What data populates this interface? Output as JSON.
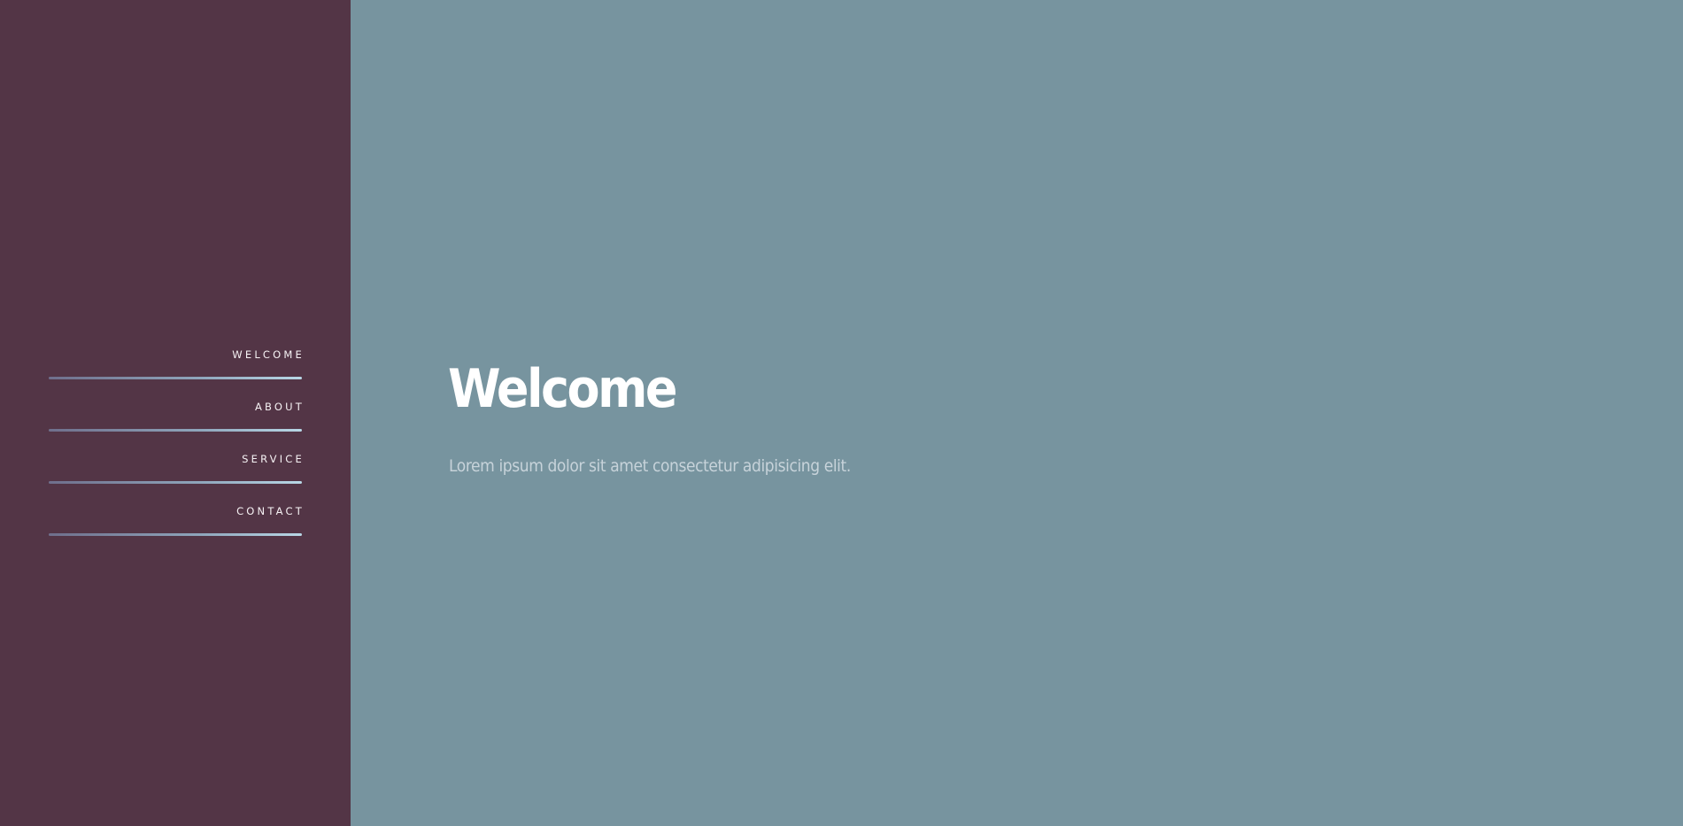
{
  "colors": {
    "sidebar_bg": "#533546",
    "main_bg": "#77949f",
    "nav_text": "#f6f2f4",
    "nav_line_start": "#6f6f8c",
    "nav_line_end": "#b8d7e6",
    "title_text": "#ffffff",
    "subtitle_text": "#c7d3da"
  },
  "sidebar": {
    "nav": [
      {
        "label": "WELCOME"
      },
      {
        "label": "ABOUT"
      },
      {
        "label": "SERVICE"
      },
      {
        "label": "CONTACT"
      }
    ]
  },
  "main": {
    "title": "Welcome",
    "subtitle": "Lorem ipsum dolor sit amet consectetur adipisicing elit."
  }
}
